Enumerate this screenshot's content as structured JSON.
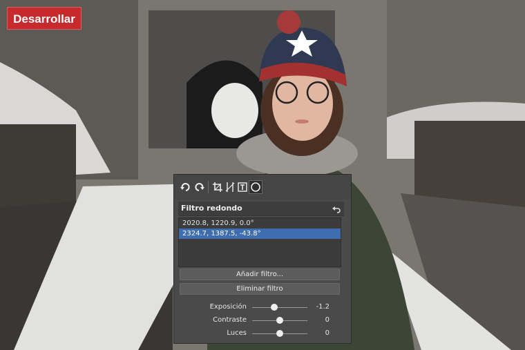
{
  "badge": {
    "label": "Desarrollar",
    "color": "#c62a2c"
  },
  "panel": {
    "title": "Filtro redondo",
    "toolbar": {
      "icons": [
        "rotate-left-icon",
        "rotate-right-icon",
        "crop-icon",
        "curves-icon",
        "text-icon",
        "radial-filter-icon"
      ],
      "active": "radial-filter-icon"
    },
    "filters": [
      {
        "label": "2020.8, 1220.9, 0.0°",
        "selected": false
      },
      {
        "label": "2324.7, 1387.5, -43.8°",
        "selected": true
      }
    ],
    "add_button": "Añadir filtro...",
    "remove_button": "Eliminar filtro",
    "sliders": [
      {
        "label": "Exposición",
        "value": "-1.2",
        "fraction": 0.4
      },
      {
        "label": "Contraste",
        "value": "0",
        "fraction": 0.5
      },
      {
        "label": "Luces",
        "value": "0",
        "fraction": 0.5
      }
    ],
    "selection_color": "#3e6db0"
  }
}
